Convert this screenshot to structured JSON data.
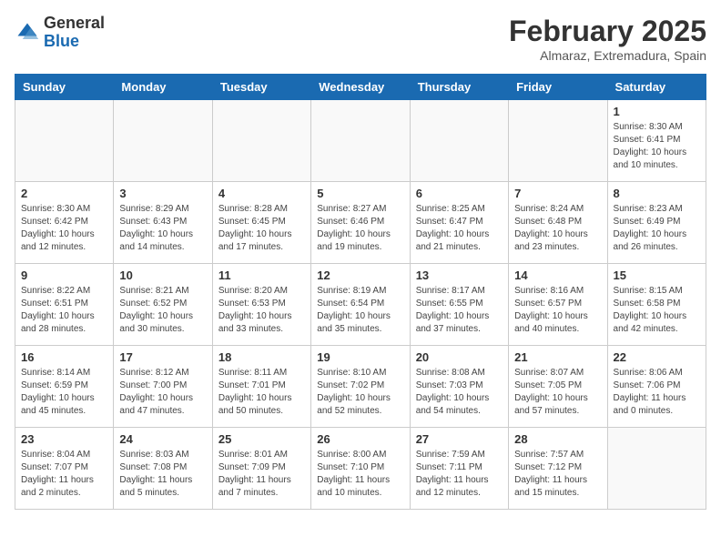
{
  "header": {
    "logo_general": "General",
    "logo_blue": "Blue",
    "month_year": "February 2025",
    "location": "Almaraz, Extremadura, Spain"
  },
  "weekdays": [
    "Sunday",
    "Monday",
    "Tuesday",
    "Wednesday",
    "Thursday",
    "Friday",
    "Saturday"
  ],
  "weeks": [
    [
      {
        "day": "",
        "info": ""
      },
      {
        "day": "",
        "info": ""
      },
      {
        "day": "",
        "info": ""
      },
      {
        "day": "",
        "info": ""
      },
      {
        "day": "",
        "info": ""
      },
      {
        "day": "",
        "info": ""
      },
      {
        "day": "1",
        "info": "Sunrise: 8:30 AM\nSunset: 6:41 PM\nDaylight: 10 hours\nand 10 minutes."
      }
    ],
    [
      {
        "day": "2",
        "info": "Sunrise: 8:30 AM\nSunset: 6:42 PM\nDaylight: 10 hours\nand 12 minutes."
      },
      {
        "day": "3",
        "info": "Sunrise: 8:29 AM\nSunset: 6:43 PM\nDaylight: 10 hours\nand 14 minutes."
      },
      {
        "day": "4",
        "info": "Sunrise: 8:28 AM\nSunset: 6:45 PM\nDaylight: 10 hours\nand 17 minutes."
      },
      {
        "day": "5",
        "info": "Sunrise: 8:27 AM\nSunset: 6:46 PM\nDaylight: 10 hours\nand 19 minutes."
      },
      {
        "day": "6",
        "info": "Sunrise: 8:25 AM\nSunset: 6:47 PM\nDaylight: 10 hours\nand 21 minutes."
      },
      {
        "day": "7",
        "info": "Sunrise: 8:24 AM\nSunset: 6:48 PM\nDaylight: 10 hours\nand 23 minutes."
      },
      {
        "day": "8",
        "info": "Sunrise: 8:23 AM\nSunset: 6:49 PM\nDaylight: 10 hours\nand 26 minutes."
      }
    ],
    [
      {
        "day": "9",
        "info": "Sunrise: 8:22 AM\nSunset: 6:51 PM\nDaylight: 10 hours\nand 28 minutes."
      },
      {
        "day": "10",
        "info": "Sunrise: 8:21 AM\nSunset: 6:52 PM\nDaylight: 10 hours\nand 30 minutes."
      },
      {
        "day": "11",
        "info": "Sunrise: 8:20 AM\nSunset: 6:53 PM\nDaylight: 10 hours\nand 33 minutes."
      },
      {
        "day": "12",
        "info": "Sunrise: 8:19 AM\nSunset: 6:54 PM\nDaylight: 10 hours\nand 35 minutes."
      },
      {
        "day": "13",
        "info": "Sunrise: 8:17 AM\nSunset: 6:55 PM\nDaylight: 10 hours\nand 37 minutes."
      },
      {
        "day": "14",
        "info": "Sunrise: 8:16 AM\nSunset: 6:57 PM\nDaylight: 10 hours\nand 40 minutes."
      },
      {
        "day": "15",
        "info": "Sunrise: 8:15 AM\nSunset: 6:58 PM\nDaylight: 10 hours\nand 42 minutes."
      }
    ],
    [
      {
        "day": "16",
        "info": "Sunrise: 8:14 AM\nSunset: 6:59 PM\nDaylight: 10 hours\nand 45 minutes."
      },
      {
        "day": "17",
        "info": "Sunrise: 8:12 AM\nSunset: 7:00 PM\nDaylight: 10 hours\nand 47 minutes."
      },
      {
        "day": "18",
        "info": "Sunrise: 8:11 AM\nSunset: 7:01 PM\nDaylight: 10 hours\nand 50 minutes."
      },
      {
        "day": "19",
        "info": "Sunrise: 8:10 AM\nSunset: 7:02 PM\nDaylight: 10 hours\nand 52 minutes."
      },
      {
        "day": "20",
        "info": "Sunrise: 8:08 AM\nSunset: 7:03 PM\nDaylight: 10 hours\nand 54 minutes."
      },
      {
        "day": "21",
        "info": "Sunrise: 8:07 AM\nSunset: 7:05 PM\nDaylight: 10 hours\nand 57 minutes."
      },
      {
        "day": "22",
        "info": "Sunrise: 8:06 AM\nSunset: 7:06 PM\nDaylight: 11 hours\nand 0 minutes."
      }
    ],
    [
      {
        "day": "23",
        "info": "Sunrise: 8:04 AM\nSunset: 7:07 PM\nDaylight: 11 hours\nand 2 minutes."
      },
      {
        "day": "24",
        "info": "Sunrise: 8:03 AM\nSunset: 7:08 PM\nDaylight: 11 hours\nand 5 minutes."
      },
      {
        "day": "25",
        "info": "Sunrise: 8:01 AM\nSunset: 7:09 PM\nDaylight: 11 hours\nand 7 minutes."
      },
      {
        "day": "26",
        "info": "Sunrise: 8:00 AM\nSunset: 7:10 PM\nDaylight: 11 hours\nand 10 minutes."
      },
      {
        "day": "27",
        "info": "Sunrise: 7:59 AM\nSunset: 7:11 PM\nDaylight: 11 hours\nand 12 minutes."
      },
      {
        "day": "28",
        "info": "Sunrise: 7:57 AM\nSunset: 7:12 PM\nDaylight: 11 hours\nand 15 minutes."
      },
      {
        "day": "",
        "info": ""
      }
    ]
  ]
}
